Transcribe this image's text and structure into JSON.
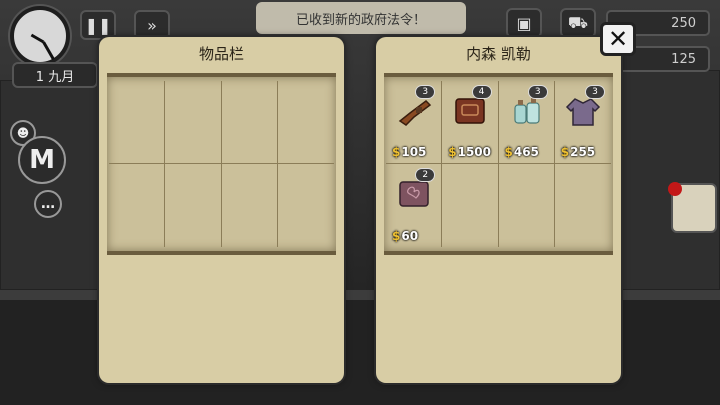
{
  "hud": {
    "date_label": "1 九月",
    "notification": "已收到新的政府法令！",
    "money_count": "250",
    "second_count": "125",
    "m_badge": "M"
  },
  "inventory": {
    "title": "物品栏"
  },
  "merchant": {
    "title": "内森 凯勒",
    "items": [
      {
        "name": "gun-item-icon",
        "qty": "3",
        "price": "105"
      },
      {
        "name": "book-item-icon",
        "qty": "4",
        "price": "1500"
      },
      {
        "name": "bottles-item-icon",
        "qty": "3",
        "price": "465"
      },
      {
        "name": "jacket-item-icon",
        "qty": "3",
        "price": "255"
      },
      {
        "name": "notebook-item-icon",
        "qty": "2",
        "price": "60"
      }
    ]
  },
  "colors": {
    "panel_bg": "#d8cda5",
    "price_dollar": "#f0c232",
    "mail_alert": "#c31818"
  },
  "currency_symbol": "$"
}
